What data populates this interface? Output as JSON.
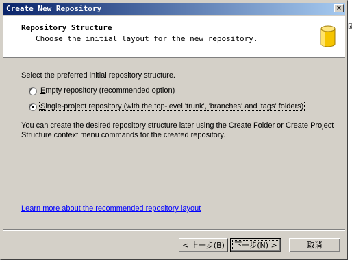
{
  "window": {
    "title": "Create New Repository",
    "close_glyph": "×"
  },
  "header": {
    "title": "Repository Structure",
    "subtitle": "Choose the initial layout for the new repository."
  },
  "content": {
    "prompt": "Select the preferred initial repository structure.",
    "options": [
      {
        "mnemonic": "E",
        "label_rest": "mpty repository (recommended option)",
        "checked": false
      },
      {
        "mnemonic": "S",
        "label_rest": "ingle-project repository (with the top-level 'trunk', 'branches' and 'tags' folders)",
        "checked": true
      }
    ],
    "note": "You can create the desired repository structure later using the Create Folder or Create Project Structure context menu commands for the created repository.",
    "learn_more_link": "Learn more about the recommended repository layout"
  },
  "buttons": {
    "back": "< 上一步(B)",
    "next": "下一步(N) >",
    "cancel": "取消"
  },
  "icons": {
    "repository": "repository-database-icon"
  },
  "colors": {
    "titlebar_start": "#0a246a",
    "titlebar_end": "#a6caf0",
    "dialog_face": "#d4d0c8",
    "link": "#0000ff",
    "repo_icon": "#f5c400"
  }
}
